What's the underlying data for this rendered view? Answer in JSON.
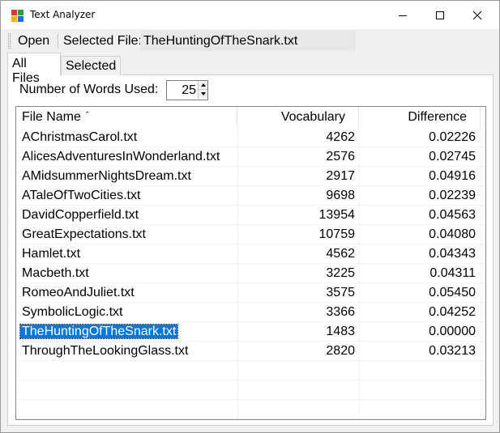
{
  "window": {
    "title": "Text Analyzer"
  },
  "toolbar": {
    "open_label": "Open",
    "selected_file_label": "Selected File:",
    "selected_file_value": "TheHuntingOfTheSnark.txt"
  },
  "tabs": [
    {
      "label": "All Files",
      "active": true
    },
    {
      "label": "Selected",
      "active": false
    }
  ],
  "words": {
    "label": "Number of Words Used:",
    "value": "25"
  },
  "table": {
    "columns": [
      {
        "label": "File Name",
        "sort": "ascending"
      },
      {
        "label": "Vocabulary"
      },
      {
        "label": "Difference"
      }
    ],
    "rows": [
      {
        "name": "AChristmasCarol.txt",
        "vocab": "4262",
        "diff": "0.02226"
      },
      {
        "name": "AlicesAdventuresInWonderland.txt",
        "vocab": "2576",
        "diff": "0.02745"
      },
      {
        "name": "AMidsummerNightsDream.txt",
        "vocab": "2917",
        "diff": "0.04916"
      },
      {
        "name": "ATaleOfTwoCities.txt",
        "vocab": "9698",
        "diff": "0.02239"
      },
      {
        "name": "DavidCopperfield.txt",
        "vocab": "13954",
        "diff": "0.04563"
      },
      {
        "name": "GreatExpectations.txt",
        "vocab": "10759",
        "diff": "0.04080"
      },
      {
        "name": "Hamlet.txt",
        "vocab": "4562",
        "diff": "0.04343"
      },
      {
        "name": "Macbeth.txt",
        "vocab": "3225",
        "diff": "0.04311"
      },
      {
        "name": "RomeoAndJuliet.txt",
        "vocab": "3575",
        "diff": "0.05450"
      },
      {
        "name": "SymbolicLogic.txt",
        "vocab": "3366",
        "diff": "0.04252"
      },
      {
        "name": "TheHuntingOfTheSnark.txt",
        "vocab": "1483",
        "diff": "0.00000",
        "selected": true
      },
      {
        "name": "ThroughTheLookingGlass.txt",
        "vocab": "2820",
        "diff": "0.03213"
      }
    ]
  },
  "colors": {
    "selection": "#0078d7",
    "window_bg": "#f0f0f0"
  },
  "icons": [
    "app-icon",
    "minimize-icon",
    "maximize-icon",
    "close-icon",
    "sort-ascending-icon",
    "spin-up-icon",
    "spin-down-icon"
  ]
}
